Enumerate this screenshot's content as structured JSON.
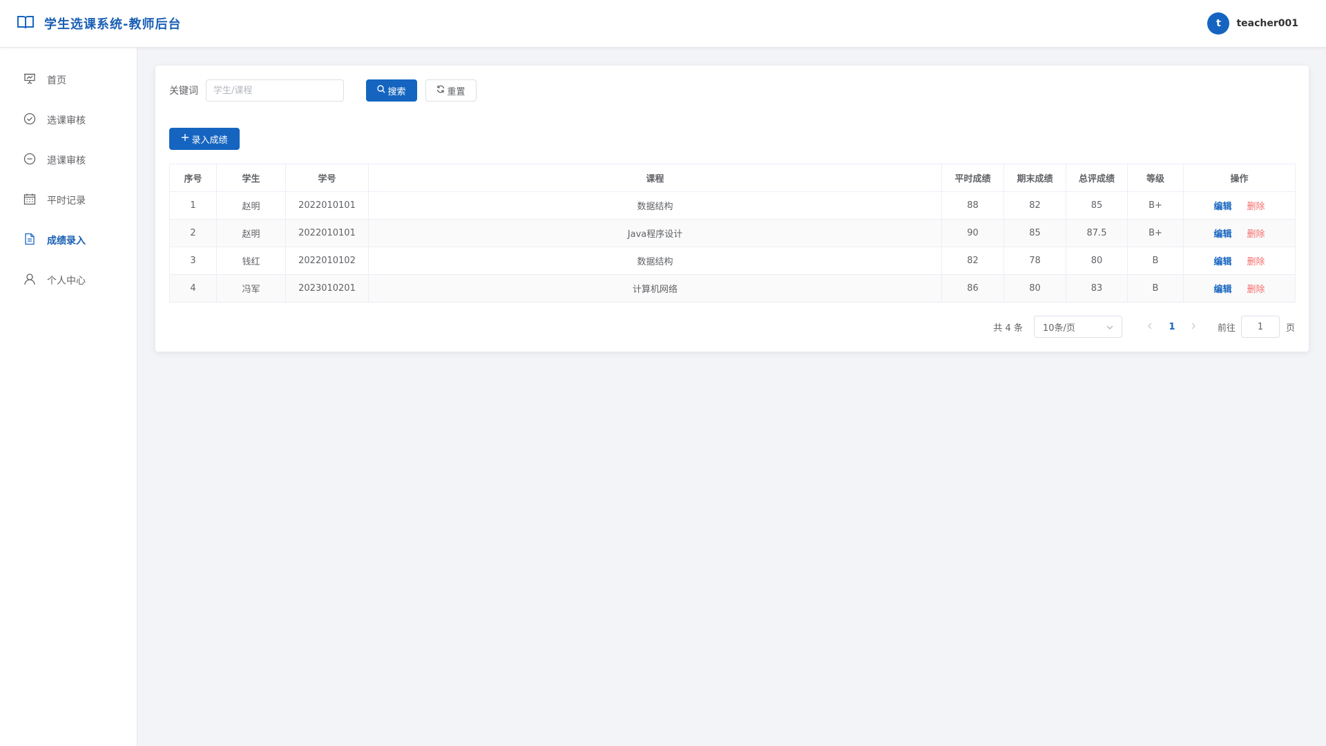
{
  "header": {
    "title": "学生选课系统-教师后台",
    "avatar_initial": "t",
    "username": "teacher001",
    "brand_color": "#1565c0"
  },
  "sidebar": {
    "items": [
      {
        "label": "首页",
        "icon": "presentation-icon",
        "active": false
      },
      {
        "label": "选课审核",
        "icon": "check-circle-icon",
        "active": false
      },
      {
        "label": "退课审核",
        "icon": "minus-circle-icon",
        "active": false
      },
      {
        "label": "平时记录",
        "icon": "calendar-icon",
        "active": false
      },
      {
        "label": "成绩录入",
        "icon": "document-icon",
        "active": true
      },
      {
        "label": "个人中心",
        "icon": "user-icon",
        "active": false
      }
    ]
  },
  "search": {
    "label": "关键词",
    "placeholder": "学生/课程",
    "value": "",
    "search_button": "搜索",
    "reset_button": "重置"
  },
  "toolbar": {
    "add_button": "录入成绩"
  },
  "table": {
    "columns": [
      "序号",
      "学生",
      "学号",
      "课程",
      "平时成绩",
      "期末成绩",
      "总评成绩",
      "等级",
      "操作"
    ],
    "rows": [
      {
        "index": "1",
        "student": "赵明",
        "student_id": "2022010101",
        "course": "数据结构",
        "usual": "88",
        "final": "82",
        "total": "85",
        "grade": "B+",
        "edit": "编辑",
        "delete": "删除"
      },
      {
        "index": "2",
        "student": "赵明",
        "student_id": "2022010101",
        "course": "Java程序设计",
        "usual": "90",
        "final": "85",
        "total": "87.5",
        "grade": "B+",
        "edit": "编辑",
        "delete": "删除"
      },
      {
        "index": "3",
        "student": "钱红",
        "student_id": "2022010102",
        "course": "数据结构",
        "usual": "82",
        "final": "78",
        "total": "80",
        "grade": "B",
        "edit": "编辑",
        "delete": "删除"
      },
      {
        "index": "4",
        "student": "冯军",
        "student_id": "2023010201",
        "course": "计算机网络",
        "usual": "86",
        "final": "80",
        "total": "83",
        "grade": "B",
        "edit": "编辑",
        "delete": "删除"
      }
    ]
  },
  "pagination": {
    "total_text": "共 4 条",
    "page_size": "10条/页",
    "current_page": "1",
    "goto_label": "前往",
    "goto_value": "1",
    "goto_suffix": "页"
  }
}
